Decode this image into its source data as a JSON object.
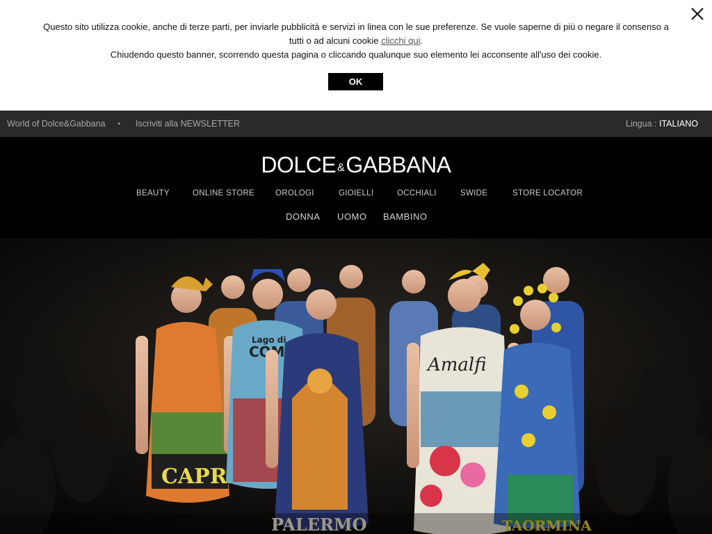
{
  "cookie": {
    "line1": "Questo sito utilizza cookie, anche di terze parti, per inviarle pubblicità e servizi in linea con le sue preferenze. Se vuole saperne di più o negare il consenso a tutti o ad alcuni cookie ",
    "link": "clicchi qui",
    "line1_end": ".",
    "line2": "Chiudendo questo banner, scorrendo questa pagina o cliccando qualunque suo elemento lei acconsente all'uso dei cookie.",
    "ok_label": "OK"
  },
  "topbar": {
    "world": "World of Dolce&Gabbana",
    "bullet": "•",
    "newsletter": "Iscriviti alla NEWSLETTER",
    "lang_label": "Lingua : ",
    "lang_value": "ITALIANO"
  },
  "header": {
    "logo_left": "DOLCE",
    "logo_amp": "&",
    "logo_right": "GABBANA",
    "nav_primary": [
      "BEAUTY",
      "ONLINE STORE",
      "OROLOGI",
      "GIOIELLI",
      "OCCHIALI",
      "SWIDE",
      "STORE LOCATOR"
    ],
    "nav_secondary": [
      "DONNA",
      "UOMO",
      "BAMBINO"
    ]
  },
  "hero": {
    "dress_texts": [
      "CAPRI",
      "COMO",
      "PALERMO",
      "Amalfi",
      "TAORMINA",
      "Lago di"
    ]
  }
}
